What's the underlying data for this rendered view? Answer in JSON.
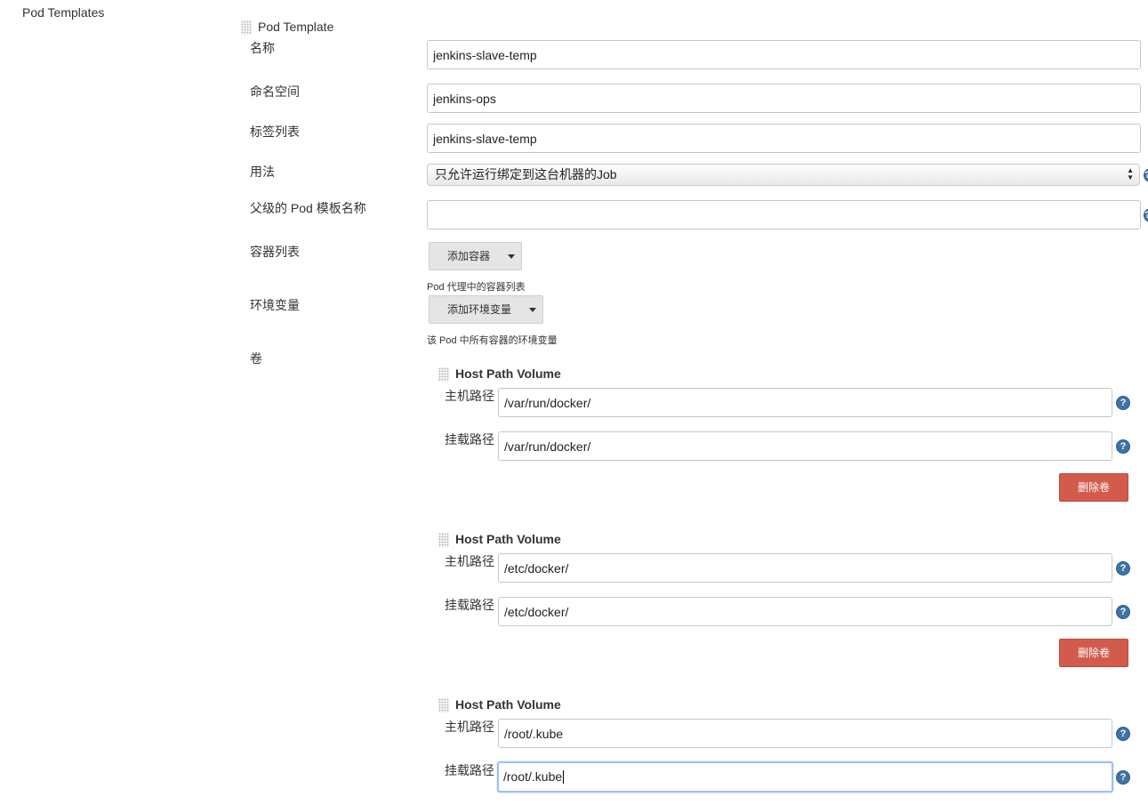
{
  "section": {
    "title": "Pod Templates"
  },
  "pod_template": {
    "title": "Pod Template",
    "fields": {
      "name": {
        "label": "名称",
        "value": "jenkins-slave-temp"
      },
      "namespace": {
        "label": "命名空间",
        "value": "jenkins-ops"
      },
      "labels": {
        "label": "标签列表",
        "value": "jenkins-slave-temp"
      },
      "usage": {
        "label": "用法",
        "value": "只允许运行绑定到这台机器的Job"
      },
      "parent": {
        "label": "父级的 Pod 模板名称",
        "value": ""
      },
      "containers": {
        "label": "容器列表",
        "button": "添加容器",
        "hint": "Pod 代理中的容器列表"
      },
      "env": {
        "label": "环境变量",
        "button": "添加环境变量",
        "hint": "该 Pod 中所有容器的环境变量"
      },
      "volumes": {
        "label": "卷"
      }
    },
    "volumes": [
      {
        "type": "Host Path Volume",
        "host_label": "主机路径",
        "host_value": "/var/run/docker/",
        "mount_label": "挂载路径",
        "mount_value": "/var/run/docker/",
        "delete_label": "删除卷"
      },
      {
        "type": "Host Path Volume",
        "host_label": "主机路径",
        "host_value": "/etc/docker/",
        "mount_label": "挂载路径",
        "mount_value": "/etc/docker/",
        "delete_label": "删除卷"
      },
      {
        "type": "Host Path Volume",
        "host_label": "主机路径",
        "host_value": "/root/.kube",
        "mount_label": "挂载路径",
        "mount_value": "/root/.kube"
      }
    ]
  },
  "icons": {
    "help": "help-icon",
    "grip": "drag-handle-icon",
    "dropdown": "caret-down-icon"
  },
  "colors": {
    "delete_button": "#d35b4c",
    "help_icon": "#3c73a8",
    "focus_border": "#9fbff0"
  }
}
